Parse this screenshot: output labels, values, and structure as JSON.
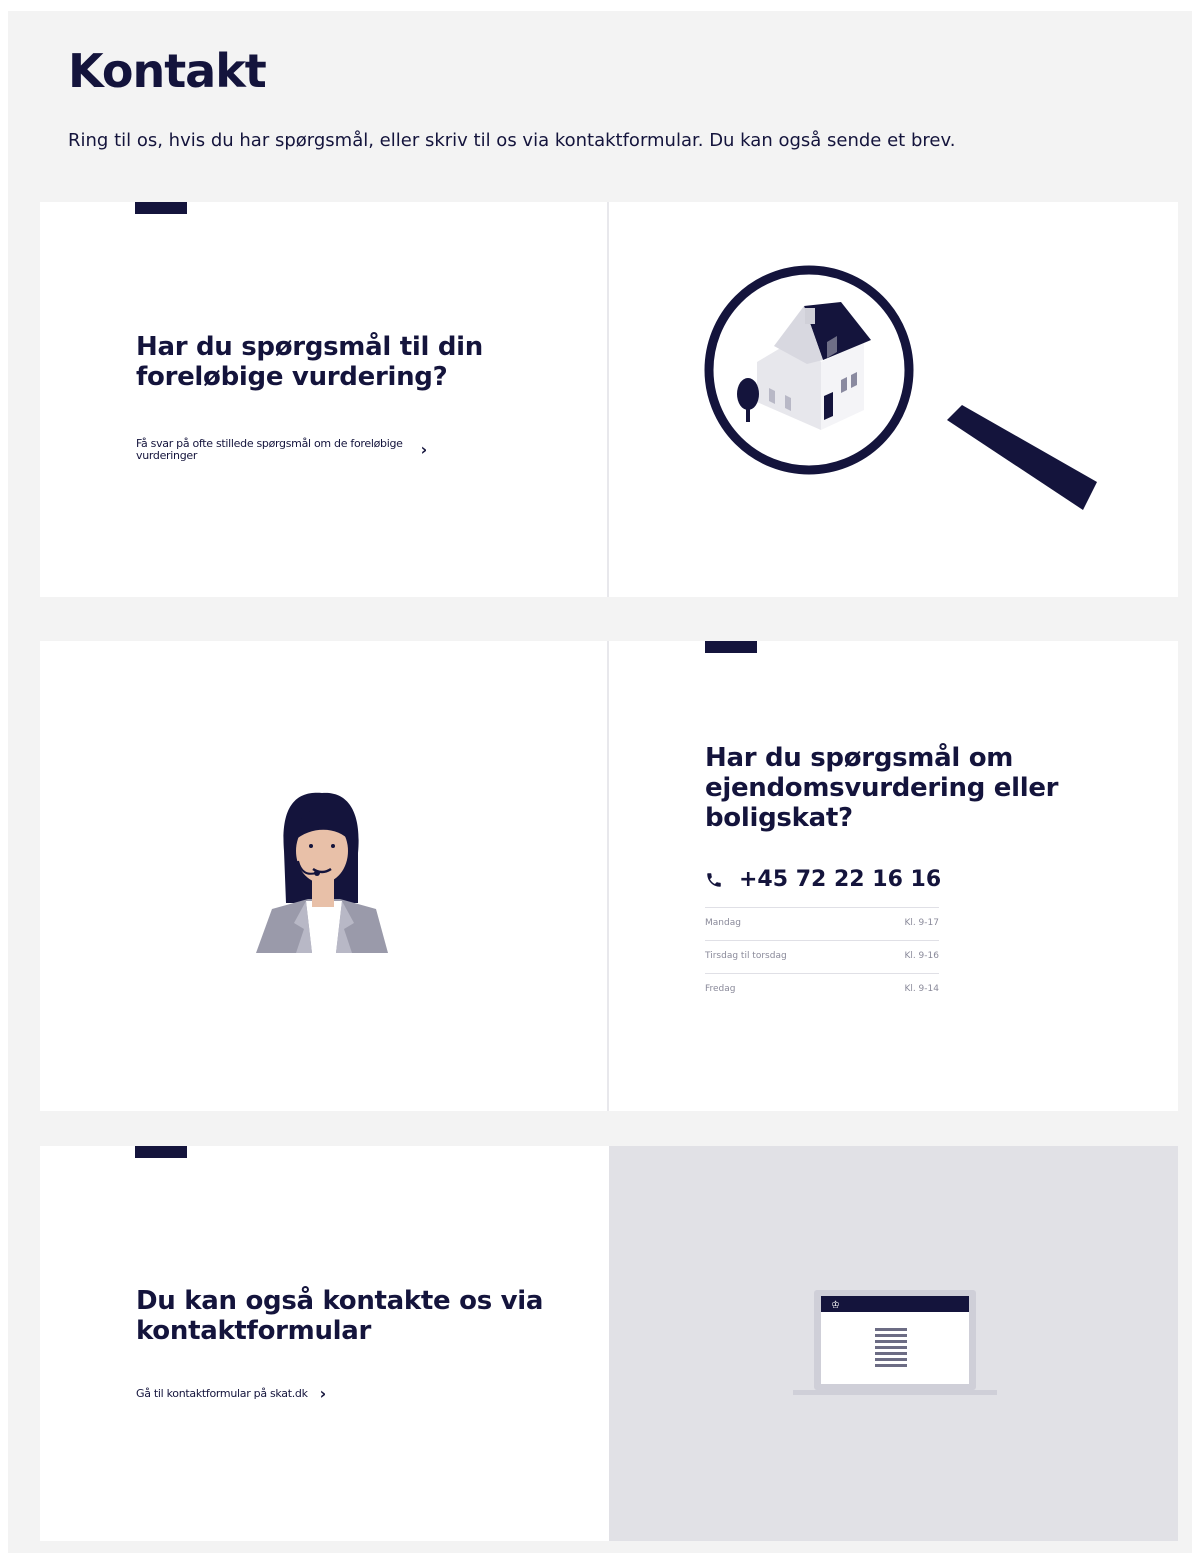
{
  "page": {
    "title": "Kontakt",
    "intro": "Ring til os, hvis du har spørgsmål, eller skriv til os via kontaktformular. Du kan også sende et brev."
  },
  "card1": {
    "heading_line1": "Har du spørgsmål til din",
    "heading_line2": "foreløbige vurdering?",
    "link_line1": "Få svar på ofte stillede spørgsmål om de foreløbige",
    "link_line2": "vurderinger",
    "link_icon": "chevron-right-icon",
    "illustration": "magnifier-house-illustration"
  },
  "card2": {
    "illustration": "customer-service-agent-illustration",
    "heading_line1": "Har du spørgsmål om",
    "heading_line2": "ejendomsvurdering eller",
    "heading_line3": "boligskat?",
    "phone_icon": "phone-icon",
    "phone": "+45 72 22 16 16",
    "hours": [
      {
        "day": "Mandag",
        "time": "Kl. 9-17"
      },
      {
        "day": "Tirsdag til torsdag",
        "time": "Kl. 9-16"
      },
      {
        "day": "Fredag",
        "time": "Kl. 9-14"
      }
    ]
  },
  "card3": {
    "heading_line1": "Du kan også kontakte os via",
    "heading_line2": "kontaktformular",
    "link": "Gå til kontaktformular på skat.dk",
    "link_icon": "chevron-right-icon",
    "illustration": "laptop-form-illustration"
  },
  "colors": {
    "navy": "#14143c",
    "page_bg": "#f3f3f3",
    "panel_grey": "#e1e1e6"
  }
}
